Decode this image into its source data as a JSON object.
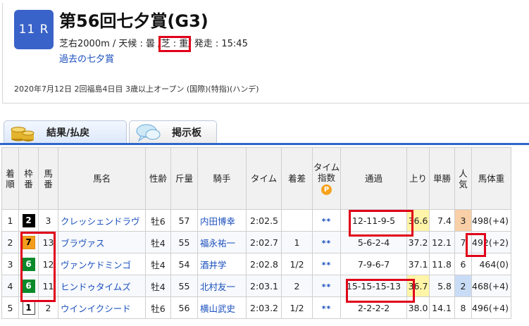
{
  "race": {
    "number": "11 R",
    "title": "第56回七夕賞(G3)",
    "info_prefix": "芝右2000m / 天候 : 曇 /",
    "info_track": "芝 : 重",
    "info_suffix": "/ 発走 : 15:45",
    "past_link": "過去の七夕賞",
    "meta": "2020年7月12日 2回福島4日目 3歳以上オープン (国際)(特指)(ハンデ)"
  },
  "tabs": [
    {
      "label": "結果/払戻",
      "icon": "coins-icon",
      "active": true
    },
    {
      "label": "掲示板",
      "icon": "speech-bubble-icon",
      "active": false
    }
  ],
  "table": {
    "headers": {
      "rank": [
        "着",
        "順"
      ],
      "waku": [
        "枠",
        "番"
      ],
      "umaban": [
        "馬",
        "番"
      ],
      "name": "馬名",
      "sexage": "性齢",
      "kinryo": "斤量",
      "jockey": "騎手",
      "time": "タイム",
      "margin": "着差",
      "tindex": [
        "タイム",
        "指数"
      ],
      "tindex_badge": "P",
      "passing": "通過",
      "last3f": "上り",
      "odds": "単勝",
      "pop": [
        "人",
        "気"
      ],
      "weight": "馬体重"
    },
    "rows": [
      {
        "rank": "1",
        "waku": "2",
        "umaban": "3",
        "name": "クレッシェンドラヴ",
        "sexage": "牡6",
        "kinryo": "57",
        "jockey": "内田博幸",
        "time": "2:02.5",
        "margin": "",
        "tindex": "**",
        "passing": "12-11-9-5",
        "last3f": "36.6",
        "odds": "7.4",
        "pop": "3",
        "weight": "498(+4)"
      },
      {
        "rank": "2",
        "waku": "7",
        "umaban": "13",
        "name": "ブラヴァス",
        "sexage": "牡4",
        "kinryo": "55",
        "jockey": "福永祐一",
        "time": "2:02.7",
        "margin": "1",
        "tindex": "**",
        "passing": "5-6-2-4",
        "last3f": "37.2",
        "odds": "12.1",
        "pop": "7",
        "weight": "492(+2)"
      },
      {
        "rank": "3",
        "waku": "6",
        "umaban": "12",
        "name": "ヴァンケドミンゴ",
        "sexage": "牡4",
        "kinryo": "54",
        "jockey": "酒井学",
        "time": "2:02.8",
        "margin": "1/2",
        "tindex": "**",
        "passing": "7-9-6-7",
        "last3f": "37.1",
        "odds": "11.8",
        "pop": "6",
        "weight": "464(0)"
      },
      {
        "rank": "4",
        "waku": "6",
        "umaban": "11",
        "name": "ヒンドゥタイムズ",
        "sexage": "牡4",
        "kinryo": "55",
        "jockey": "北村友一",
        "time": "2:03.1",
        "margin": "2",
        "tindex": "**",
        "passing": "15-15-15-13",
        "last3f": "36.7",
        "odds": "5.8",
        "pop": "2",
        "weight": "468(+4)"
      },
      {
        "rank": "5",
        "waku": "1",
        "umaban": "2",
        "name": "ウインイクシード",
        "sexage": "牡6",
        "kinryo": "56",
        "jockey": "横山武史",
        "time": "2:03.2",
        "margin": "1/2",
        "tindex": "**",
        "passing": "2-2-2-2",
        "last3f": "38.0",
        "odds": "14.1",
        "pop": "8",
        "weight": "496(+4)"
      }
    ]
  },
  "colors": {
    "accent": "#2f66c9",
    "highlight": "#e0001a",
    "waku1": "#ffffff",
    "waku2": "#000000",
    "waku6": "#0a8a2a",
    "waku7": "#f29d1c",
    "best_last3f": "#fff5a8"
  }
}
